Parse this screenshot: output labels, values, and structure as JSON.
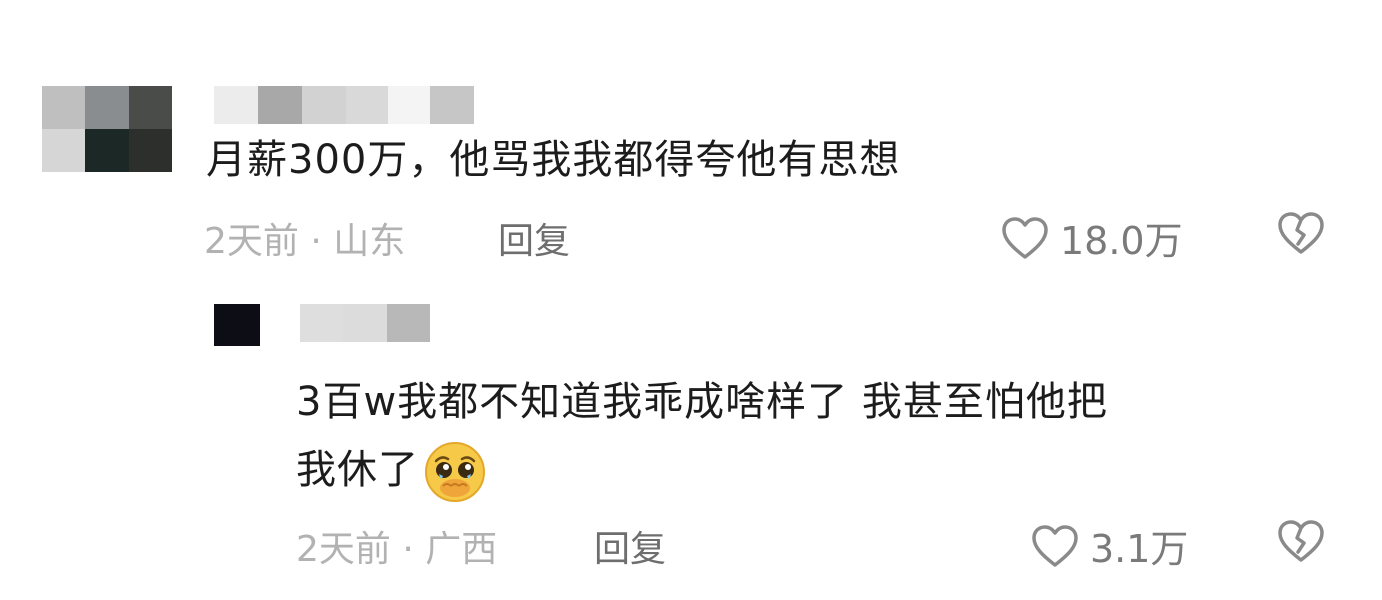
{
  "comments": [
    {
      "text": "月薪300万，他骂我我都得夸他有思想",
      "meta": "2天前 · 山东",
      "reply_label": "回复",
      "likes": "18.0万",
      "avatar_colors": [
        "#bfbfbf",
        "#8a8d90",
        "#4a4c49",
        "#d6d6d6",
        "#1b2826",
        "#2d2f2d"
      ],
      "name_colors": [
        "#ececec",
        "#a8a8a8",
        "#d2d2d2",
        "#d9d9d9",
        "#f4f4f4",
        "#c6c6c6"
      ]
    },
    {
      "text_line1": "3百w我都不知道我乖成啥样了 我甚至怕他把",
      "text_line2": "我休了",
      "emoji_name": "pleading-covering-mouth-emoji",
      "meta": "2天前 · 广西",
      "reply_label": "回复",
      "likes": "3.1万",
      "avatar_color": "#0d0d16",
      "name_colors": [
        "#dedede",
        "#dcdcdc",
        "#b8b8b8"
      ]
    }
  ],
  "icons": {
    "like": "heart-outline-icon",
    "dislike": "broken-heart-icon"
  },
  "colors": {
    "text": "#1c1c1c",
    "meta": "#b2b2b2",
    "reply": "#6e6e6e",
    "icon": "#8a8a8a"
  }
}
